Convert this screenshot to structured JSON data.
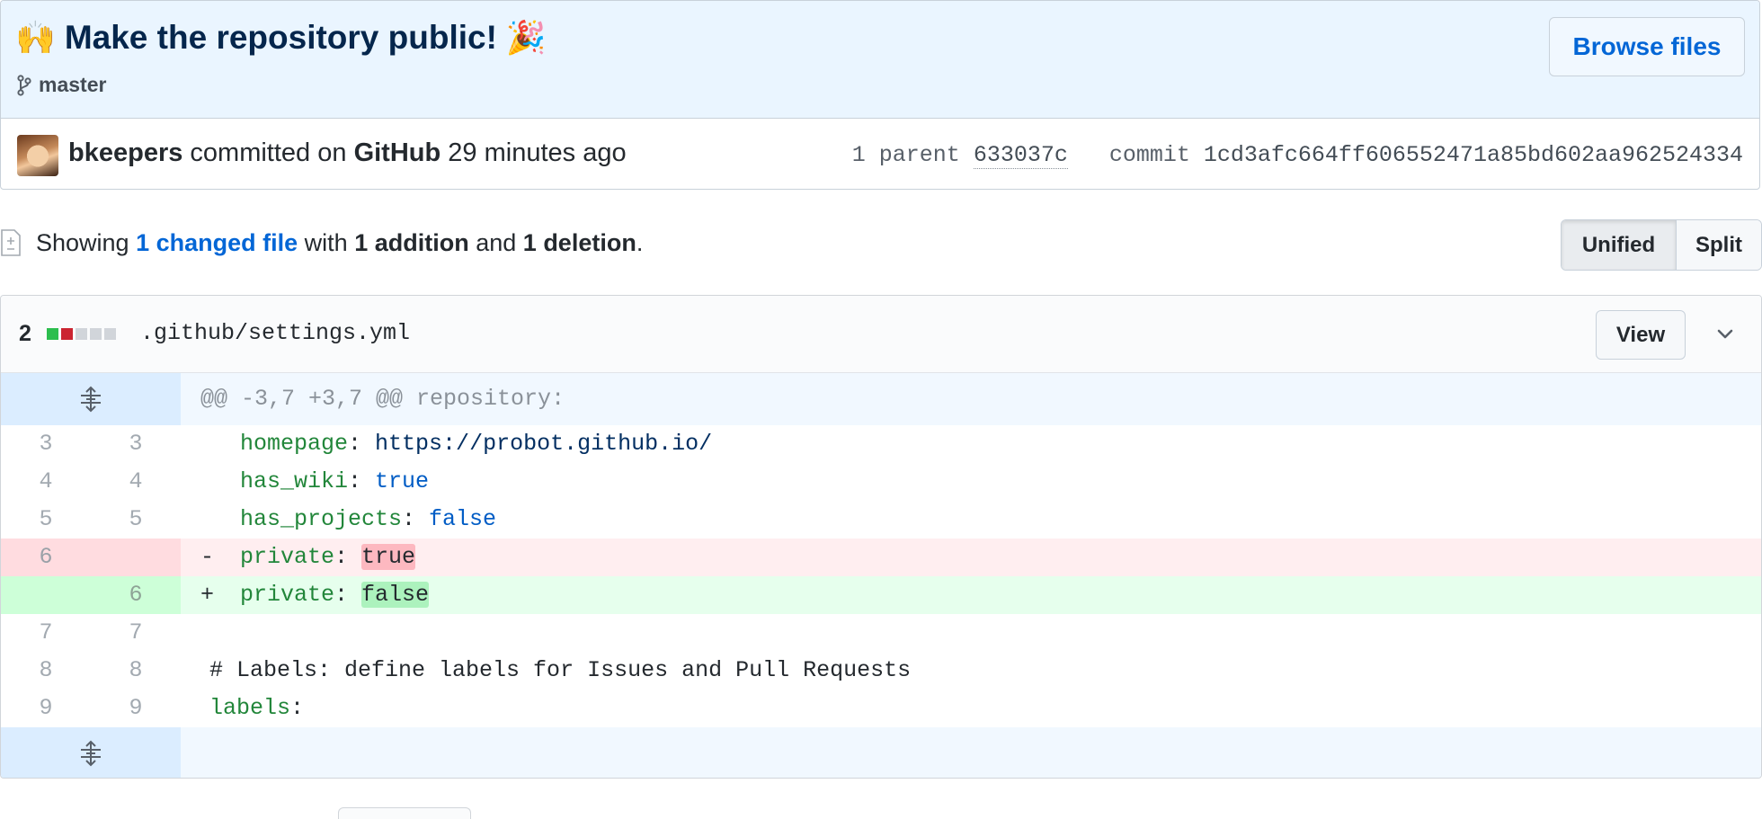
{
  "commit": {
    "emoji_left": "🙌",
    "title": "Make the repository public!",
    "emoji_right": "🎉",
    "branch": "master",
    "browse_button": "Browse files",
    "author": "bkeepers",
    "committed_text": "committed on",
    "platform": "GitHub",
    "time_ago": "29 minutes ago",
    "parent_label": "1 parent",
    "parent_sha": "633037c",
    "commit_label": "commit",
    "commit_sha": "1cd3afc664ff606552471a85bd602aa962524334"
  },
  "summary": {
    "showing": "Showing",
    "changed_files": "1 changed file",
    "with": "with",
    "additions": "1 addition",
    "and": "and",
    "deletions": "1 deletion",
    "period": "."
  },
  "view_toggle": {
    "unified": "Unified",
    "split": "Split",
    "selected": "Unified"
  },
  "file": {
    "change_count": "2",
    "diffstat": [
      "#2cbe4e",
      "#cb2431",
      "#d1d5da",
      "#d1d5da",
      "#d1d5da"
    ],
    "name": ".github/settings.yml",
    "view_button": "View"
  },
  "diff": {
    "hunk_header": "@@ -3,7 +3,7 @@ repository:",
    "lines": [
      {
        "type": "ctx",
        "old": "3",
        "new": "3",
        "indent": "  ",
        "key": "homepage",
        "sep": ": ",
        "value": "https://probot.github.io/",
        "value_class": "val"
      },
      {
        "type": "ctx",
        "old": "4",
        "new": "4",
        "indent": "  ",
        "key": "has_wiki",
        "sep": ": ",
        "value": "true",
        "value_class": "bool"
      },
      {
        "type": "ctx",
        "old": "5",
        "new": "5",
        "indent": "  ",
        "key": "has_projects",
        "sep": ": ",
        "value": "false",
        "value_class": "bool"
      },
      {
        "type": "del",
        "old": "6",
        "new": "",
        "sign": "-",
        "key": "private",
        "sep": ": ",
        "value": "true"
      },
      {
        "type": "add",
        "old": "",
        "new": "6",
        "sign": "+",
        "key": "private",
        "sep": ": ",
        "value": "false"
      },
      {
        "type": "ctx",
        "old": "7",
        "new": "7",
        "text": ""
      },
      {
        "type": "ctx",
        "old": "8",
        "new": "8",
        "text": "# Labels: define labels for Issues and Pull Requests"
      },
      {
        "type": "ctx",
        "old": "9",
        "new": "9",
        "key": "labels",
        "sep": ":"
      }
    ]
  }
}
